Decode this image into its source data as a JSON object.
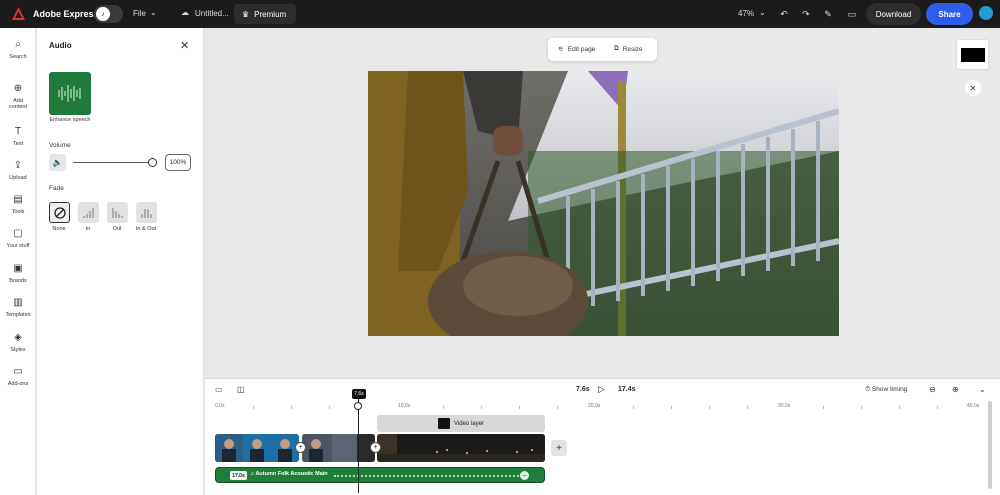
{
  "topbar": {
    "app_name": "Adobe Express",
    "file_label": "File",
    "doc_title": "Untitled...",
    "premium_label": "Premium",
    "zoom": "47%",
    "download_label": "Download",
    "share_label": "Share",
    "colors": {
      "bg": "#1b1b1b",
      "share": "#2f5ce8"
    }
  },
  "rail": {
    "items": [
      {
        "label": "Search",
        "icon": "search-icon"
      },
      {
        "label": "Add content",
        "icon": "plus-circle-icon"
      },
      {
        "label": "Text",
        "icon": "text-icon"
      },
      {
        "label": "Upload",
        "icon": "upload-icon"
      },
      {
        "label": "Tools",
        "icon": "toolbox-icon"
      },
      {
        "label": "Your stuff",
        "icon": "folder-icon"
      },
      {
        "label": "Brands",
        "icon": "brand-icon"
      },
      {
        "label": "Templates",
        "icon": "templates-icon"
      },
      {
        "label": "Styles",
        "icon": "styles-icon"
      },
      {
        "label": "Add-ons",
        "icon": "addons-icon"
      }
    ]
  },
  "panel": {
    "title": "Audio",
    "enhance_label": "Enhance speech",
    "volume_label": "Volume",
    "volume_value": "100%",
    "volume_level": 1.0,
    "fade_label": "Fade",
    "fade_options": [
      "None",
      "In",
      "Out",
      "In & Out"
    ],
    "fade_selected": "None"
  },
  "pagebar": {
    "edit_page": "Edit page",
    "resize": "Resize"
  },
  "timeline": {
    "current_time": "7.6s",
    "total_time": "17.4s",
    "playhead_label": "7.6s",
    "show_timing": "Show timing",
    "ruler_labels": [
      "0.0s",
      "10.0s",
      "20.0s",
      "30.0s",
      "40.0s"
    ],
    "video_layer_label": "Video layer",
    "audio_duration": "17.0s",
    "audio_name": "Autumn Folk Acoustic Main"
  }
}
